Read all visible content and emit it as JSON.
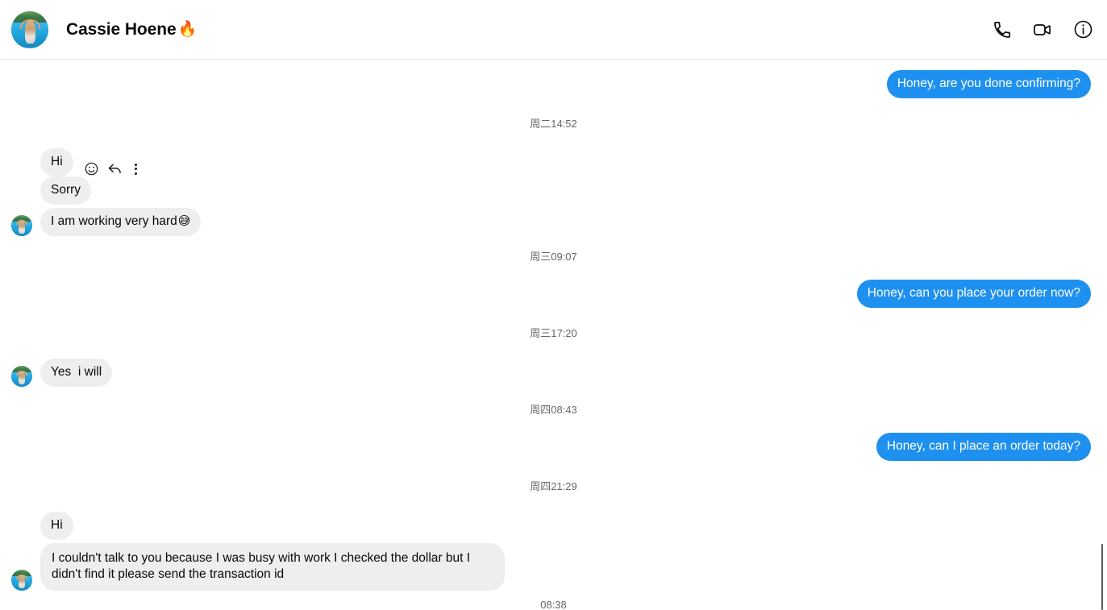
{
  "header": {
    "contact_name": "Cassie Hoene",
    "contact_name_emoji": "🔥",
    "avatar_name": "contact-avatar",
    "actions": [
      {
        "name": "voice-call-icon",
        "label": "Voice call"
      },
      {
        "name": "video-call-icon",
        "label": "Video call"
      },
      {
        "name": "conversation-info-icon",
        "label": "Conversation information"
      }
    ]
  },
  "message_actions": {
    "react_label": "React",
    "reply_label": "Reply",
    "more_label": "More"
  },
  "conversation": {
    "messages": [
      {
        "id": "m1",
        "direction": "outgoing",
        "text": "Honey, are you done confirming?"
      },
      {
        "id": "t1",
        "type": "timestamp",
        "text": "周二14:52"
      },
      {
        "id": "m2",
        "direction": "incoming",
        "text": "Hi",
        "hovered": true
      },
      {
        "id": "m3",
        "direction": "incoming",
        "text": "Sorry"
      },
      {
        "id": "m4",
        "direction": "incoming",
        "text": "I am working very hard",
        "emoji": "😅",
        "show_avatar": true
      },
      {
        "id": "t2",
        "type": "timestamp",
        "text": "周三09:07"
      },
      {
        "id": "m5",
        "direction": "outgoing",
        "text": "Honey, can you place your order now?"
      },
      {
        "id": "t3",
        "type": "timestamp",
        "text": "周三17:20"
      },
      {
        "id": "m6",
        "direction": "incoming",
        "text": "Yes  i will",
        "show_avatar": true
      },
      {
        "id": "t4",
        "type": "timestamp",
        "text": "周四08:43"
      },
      {
        "id": "m7",
        "direction": "outgoing",
        "text": "Honey, can I place an order today?"
      },
      {
        "id": "t5",
        "type": "timestamp",
        "text": "周四21:29"
      },
      {
        "id": "m8",
        "direction": "incoming",
        "text": "Hi"
      },
      {
        "id": "m9",
        "direction": "incoming",
        "text": "I couldn't talk to you because I was busy with work I checked the dollar but I didn't find it please send the transaction id",
        "show_avatar": true
      },
      {
        "id": "t6",
        "type": "timestamp",
        "text": "08:38"
      }
    ]
  },
  "colors": {
    "outgoing_bubble": "#1e90f0",
    "incoming_bubble": "#eeeeee",
    "outgoing_text": "#ffffff",
    "incoming_text": "#090909",
    "timestamp_text": "#65676b",
    "header_border": "#e2e2e2"
  }
}
